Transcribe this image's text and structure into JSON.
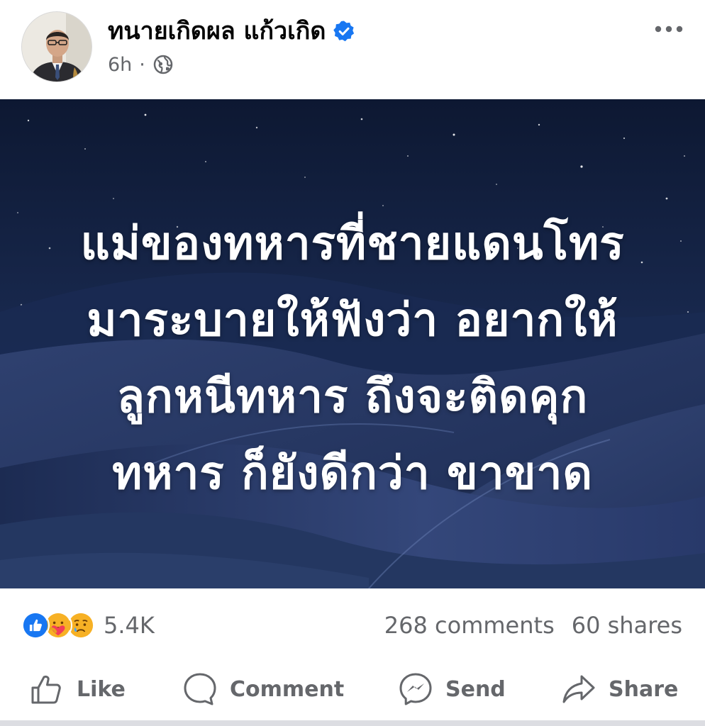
{
  "post": {
    "author": {
      "name": "ทนายเกิดผล แก้วเกิด",
      "verified": true,
      "avatar": "avatar-photo"
    },
    "time": "6h",
    "time_separator": "·",
    "audience_icon": "globe-icon",
    "more_icon": "more-options-icon",
    "image_text_lines": [
      "แม่ของทหารที่ชายแดนโทร",
      "มาระบายให้ฟังว่า อยากให้",
      "ลูกหนีทหาร ถึงจะติดคุก",
      "ทหาร ก็ยังดีกว่า ขาขาด"
    ],
    "reactions": {
      "icons": [
        "like-icon",
        "care-icon",
        "sad-icon"
      ],
      "count": "5.4K"
    },
    "comments": "268 comments",
    "shares": "60 shares"
  },
  "actions": {
    "like": "Like",
    "comment": "Comment",
    "send": "Send",
    "share": "Share"
  },
  "colors": {
    "accent": "#1877f2",
    "secondary_text": "#65676b",
    "primary_text": "#050505",
    "image_bg": "#101c3a"
  }
}
